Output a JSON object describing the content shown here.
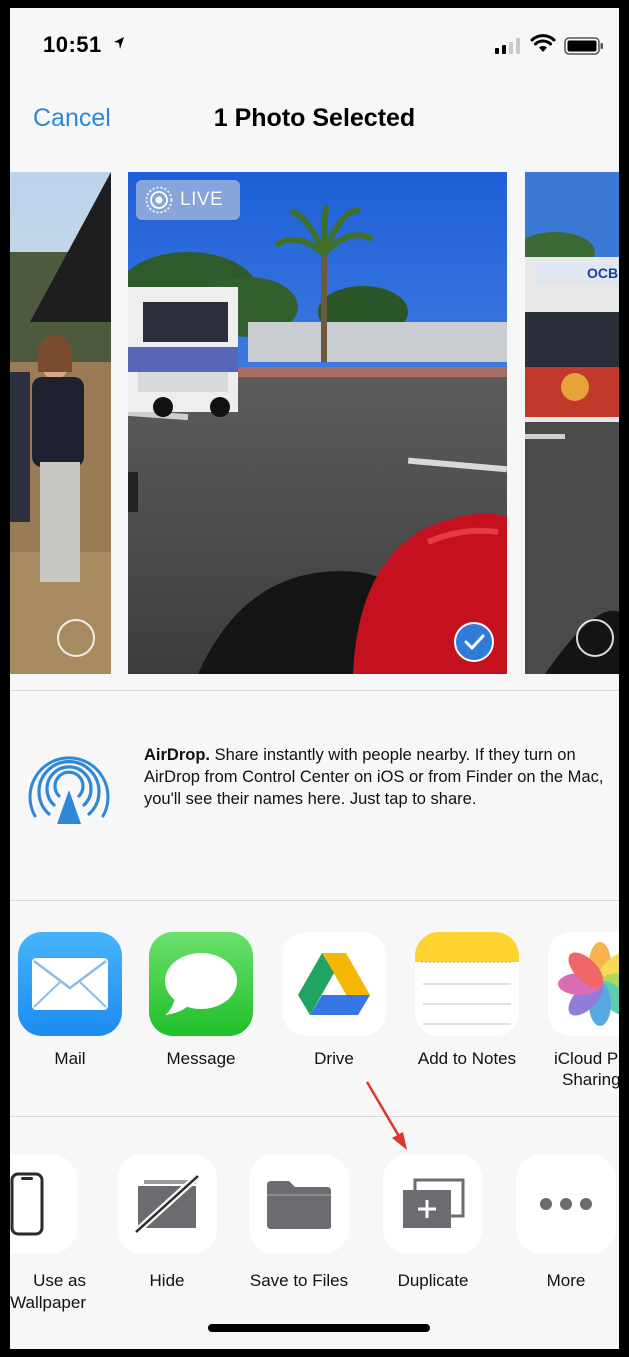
{
  "status_bar": {
    "time": "10:51"
  },
  "nav": {
    "cancel_label": "Cancel",
    "title": "1 Photo Selected"
  },
  "photos": {
    "live_label": "LIVE",
    "items": [
      {
        "selected": false
      },
      {
        "selected": true,
        "live": true
      },
      {
        "selected": false
      }
    ]
  },
  "airdrop": {
    "title": "AirDrop.",
    "description": " Share instantly with people nearby. If they turn on AirDrop from Control Center on iOS or from Finder on the Mac, you'll see their names here. Just tap to share."
  },
  "apps": [
    {
      "label": "Mail",
      "icon": "mail-icon"
    },
    {
      "label": "Message",
      "icon": "message-icon"
    },
    {
      "label": "Drive",
      "icon": "drive-icon"
    },
    {
      "label": "Add to Notes",
      "icon": "notes-icon"
    },
    {
      "label": "iCloud Ph",
      "label2": "Sharing",
      "icon": "photos-icon"
    }
  ],
  "actions": [
    {
      "label": "Use as",
      "label2": "Wallpaper",
      "icon": "phone-icon"
    },
    {
      "label": "Hide",
      "icon": "hide-icon"
    },
    {
      "label": "Save to Files",
      "icon": "folder-icon"
    },
    {
      "label": "Duplicate",
      "icon": "duplicate-icon"
    },
    {
      "label": "More",
      "icon": "more-icon"
    }
  ],
  "colors": {
    "accent": "#2f87d8",
    "annotation_arrow": "#e0332d"
  }
}
